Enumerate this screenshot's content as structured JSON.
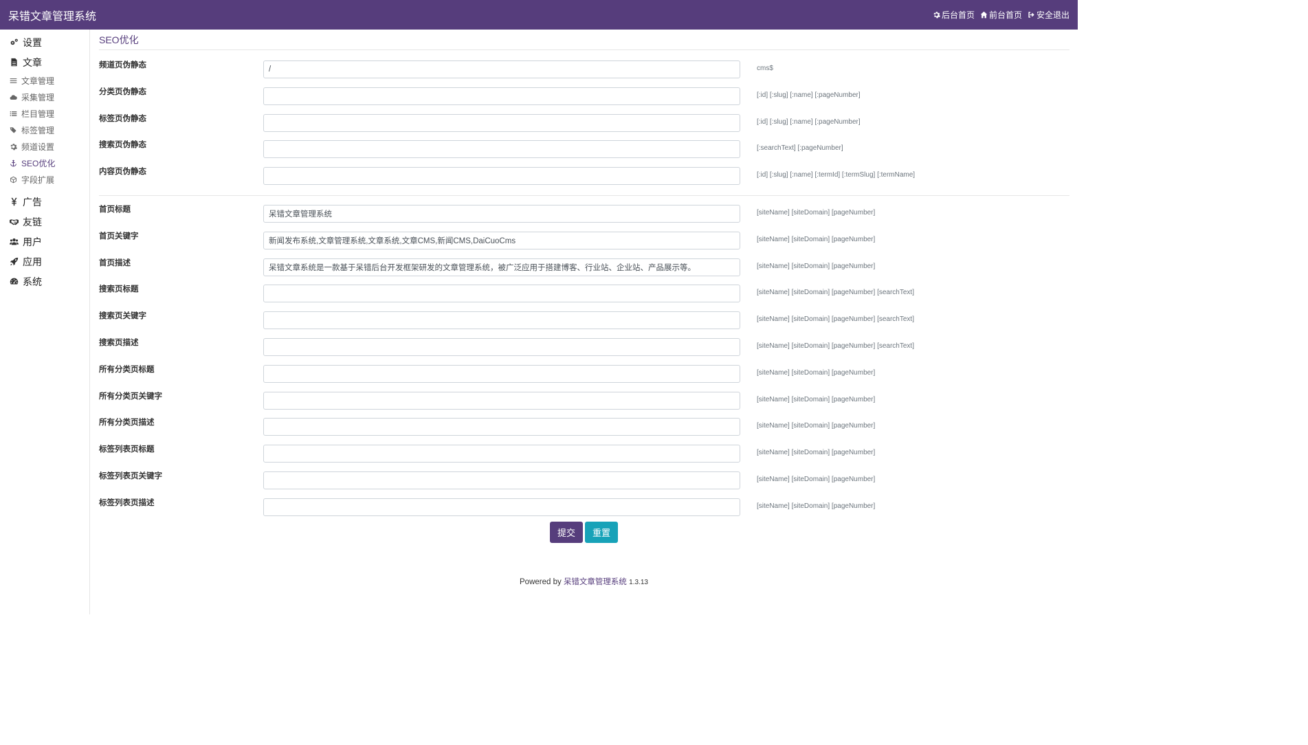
{
  "header": {
    "title": "呆错文章管理系统",
    "links": [
      {
        "label": "后台首页",
        "icon": "gear-icon"
      },
      {
        "label": "前台首页",
        "icon": "home-icon"
      },
      {
        "label": "安全退出",
        "icon": "sign-out-icon"
      }
    ]
  },
  "sidebar": {
    "groups": [
      {
        "label": "设置",
        "icon": "cogs-icon"
      },
      {
        "label": "文章",
        "icon": "file-icon"
      },
      {
        "label": "广告",
        "icon": "yen-icon"
      },
      {
        "label": "友链",
        "icon": "handshake-icon"
      },
      {
        "label": "用户",
        "icon": "users-icon"
      },
      {
        "label": "应用",
        "icon": "rocket-icon"
      },
      {
        "label": "系统",
        "icon": "dashboard-icon"
      }
    ],
    "article_items": [
      {
        "label": "文章管理",
        "icon": "bars-icon"
      },
      {
        "label": "采集管理",
        "icon": "cloud-icon"
      },
      {
        "label": "栏目管理",
        "icon": "list-icon"
      },
      {
        "label": "标签管理",
        "icon": "tags-icon"
      },
      {
        "label": "频道设置",
        "icon": "gear-icon"
      },
      {
        "label": "SEO优化",
        "icon": "anchor-icon",
        "active": true
      },
      {
        "label": "字段扩展",
        "icon": "cube-icon"
      }
    ]
  },
  "main": {
    "title": "SEO优化",
    "rewrite_fields": [
      {
        "label": "频道页伪静态",
        "value": "/",
        "hint": "cms$"
      },
      {
        "label": "分类页伪静态",
        "value": "",
        "hint": "[:id] [:slug] [:name] [:pageNumber]"
      },
      {
        "label": "标签页伪静态",
        "value": "",
        "hint": "[:id] [:slug] [:name] [:pageNumber]"
      },
      {
        "label": "搜索页伪静态",
        "value": "",
        "hint": "[:searchText] [:pageNumber]"
      },
      {
        "label": "内容页伪静态",
        "value": "",
        "hint": "[:id] [:slug] [:name] [:termId] [:termSlug] [:termName]"
      }
    ],
    "seo_fields": [
      {
        "label": "首页标题",
        "value": "呆错文章管理系统",
        "hint": "[siteName] [siteDomain] [pageNumber]"
      },
      {
        "label": "首页关键字",
        "value": "新闻发布系统,文章管理系统,文章系统,文章CMS,新闻CMS,DaiCuoCms",
        "hint": "[siteName] [siteDomain] [pageNumber]"
      },
      {
        "label": "首页描述",
        "value": "呆错文章系统是一款基于呆错后台开发框架研发的文章管理系统，被广泛应用于搭建博客、行业站、企业站、产品展示等。",
        "hint": "[siteName] [siteDomain] [pageNumber]"
      },
      {
        "label": "搜索页标题",
        "value": "",
        "hint": "[siteName] [siteDomain] [pageNumber] [searchText]"
      },
      {
        "label": "搜索页关键字",
        "value": "",
        "hint": "[siteName] [siteDomain] [pageNumber] [searchText]"
      },
      {
        "label": "搜索页描述",
        "value": "",
        "hint": "[siteName] [siteDomain] [pageNumber] [searchText]"
      },
      {
        "label": "所有分类页标题",
        "value": "",
        "hint": "[siteName] [siteDomain] [pageNumber]"
      },
      {
        "label": "所有分类页关键字",
        "value": "",
        "hint": "[siteName] [siteDomain] [pageNumber]"
      },
      {
        "label": "所有分类页描述",
        "value": "",
        "hint": "[siteName] [siteDomain] [pageNumber]"
      },
      {
        "label": "标签列表页标题",
        "value": "",
        "hint": "[siteName] [siteDomain] [pageNumber]"
      },
      {
        "label": "标签列表页关键字",
        "value": "",
        "hint": "[siteName] [siteDomain] [pageNumber]"
      },
      {
        "label": "标签列表页描述",
        "value": "",
        "hint": "[siteName] [siteDomain] [pageNumber]"
      }
    ],
    "submit_label": "提交",
    "reset_label": "重置"
  },
  "footer": {
    "prefix": "Powered by",
    "link": "呆错文章管理系统",
    "version": "1.3.13"
  },
  "colors": {
    "primary": "#563d7c",
    "info": "#17a2b8"
  }
}
